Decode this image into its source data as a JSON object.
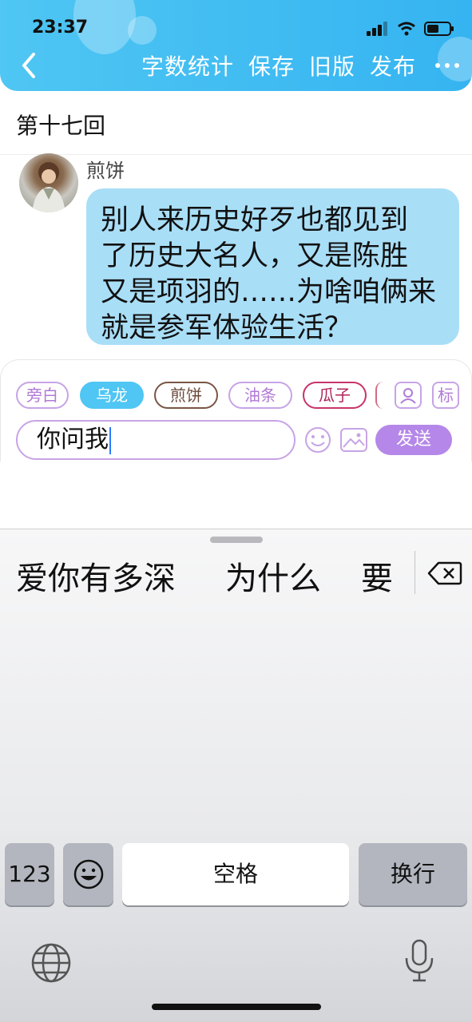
{
  "status_bar": {
    "time": "23:37"
  },
  "header": {
    "nav_items": [
      "字数统计",
      "保存",
      "旧版",
      "发布"
    ],
    "bg_color": "#35b4f1"
  },
  "chapter": {
    "title": "第十七回"
  },
  "message": {
    "sender": "煎饼",
    "lines": [
      "别人来历史好歹也都见到",
      "了历史大名人，又是陈胜",
      "又是项羽的……为啥咱俩来",
      "就是参军体验生活？"
    ],
    "bubble_color": "#a9def7"
  },
  "role_chips": [
    {
      "label": "旁白"
    },
    {
      "label": "乌龙"
    },
    {
      "label": "煎饼"
    },
    {
      "label": "油条"
    },
    {
      "label": "瓜子"
    }
  ],
  "compose": {
    "tag_button": "标",
    "input_value": "你问我",
    "send_label": "发送",
    "accent": "#b587e8"
  },
  "keyboard": {
    "candidates": [
      "爱你有多深",
      "为什么",
      "要"
    ],
    "keys": {
      "num": "123",
      "space": "空格",
      "return": "换行"
    }
  }
}
